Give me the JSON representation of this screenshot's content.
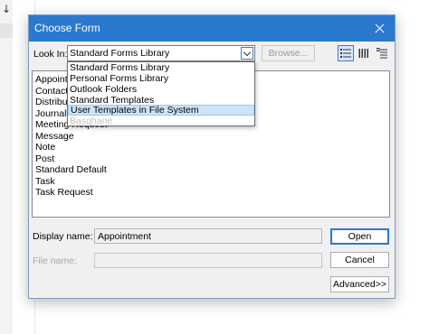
{
  "background": {
    "arrow_glyph": "↓"
  },
  "dialog": {
    "title": "Choose Form",
    "look_in_label": "Look In:",
    "look_in_value": "Standard Forms Library",
    "browse_label": "Browse...",
    "view_buttons": [
      "details-view-icon",
      "large-icons-view-icon",
      "list-view-icon"
    ],
    "dropdown_options": [
      "Standard Forms Library",
      "Personal Forms Library",
      "Outlook Folders",
      "Standard Templates",
      "User Templates in File System",
      "Basqhane"
    ],
    "dropdown_selected": "User Templates in File System",
    "form_items": [
      "Appointment",
      "Contact",
      "Distribution List",
      "Journal Entry",
      "Meeting Request",
      "Message",
      "Note",
      "Post",
      "Standard Default",
      "Task",
      "Task Request"
    ],
    "display_name_label": "Display name:",
    "display_name_value": "Appointment",
    "file_name_label": "File name:",
    "file_name_value": "",
    "open_label": "Open",
    "cancel_label": "Cancel",
    "advanced_label": "Advanced>>"
  },
  "colors": {
    "titlebar": "#2b78cf",
    "selection": "#cce4f7",
    "dialog_bg": "#f0f0f0"
  }
}
